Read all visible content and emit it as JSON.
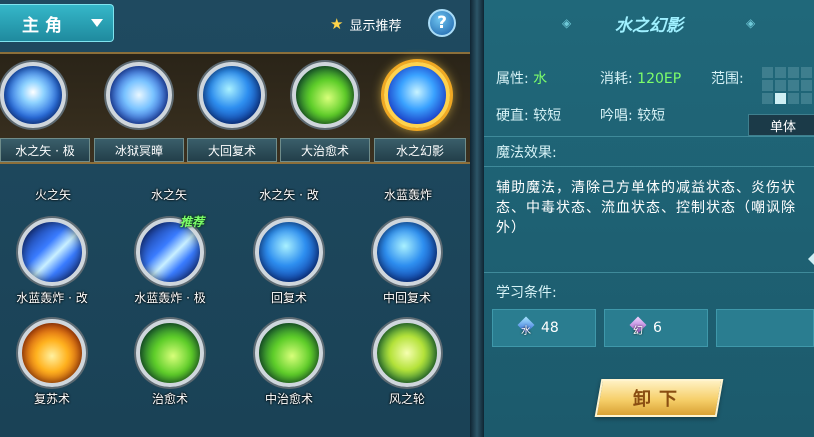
{
  "header": {
    "role_label": "主角",
    "recommend_label": "显示推荐",
    "help_label": "?"
  },
  "equipped": [
    {
      "label": "水之矢 · 极",
      "icon": "ice-arrow-icon"
    },
    {
      "label": "冰狱冥暲",
      "icon": "ice-prison-icon"
    },
    {
      "label": "大回复术",
      "icon": "bubbles-icon"
    },
    {
      "label": "大治愈术",
      "icon": "healing-sprout-icon"
    },
    {
      "label": "水之幻影",
      "icon": "water-phantom-icon",
      "selected": true
    }
  ],
  "skills": [
    {
      "name": "火之矢",
      "icon": "fire-arrow-icon"
    },
    {
      "name": "水之矢",
      "icon": "water-arrow-icon"
    },
    {
      "name": "水之矢 · 改",
      "icon": "water-arrow-icon"
    },
    {
      "name": "水蓝轰炸",
      "icon": "water-blast-icon"
    },
    {
      "name": "水蓝轰炸 · 改",
      "icon": "water-blast-icon"
    },
    {
      "name": "水蓝轰炸 · 极",
      "icon": "water-blast-icon",
      "tag": "推荐"
    },
    {
      "name": "回复术",
      "icon": "bubbles-icon"
    },
    {
      "name": "中回复术",
      "icon": "bubbles-icon"
    },
    {
      "name": "复苏术",
      "icon": "phoenix-icon"
    },
    {
      "name": "治愈术",
      "icon": "healing-sprout-icon"
    },
    {
      "name": "中治愈术",
      "icon": "healing-sprout-icon"
    },
    {
      "name": "风之轮",
      "icon": "wind-wheel-icon"
    }
  ],
  "detail": {
    "title": "水之幻影",
    "attribute_label": "属性:",
    "attribute_value": "水",
    "cost_label": "消耗:",
    "cost_value": "120EP",
    "range_label": "范围:",
    "stiffness_label": "硬直:",
    "stiffness_value": "较短",
    "chant_label": "吟唱:",
    "chant_value": "较短",
    "scope": "单体",
    "effect_label": "魔法效果:",
    "effect_text": "辅助魔法，清除己方单体的减益状态、炎伤状态、中毒状态、流血状态、控制状态（嘲讽除外）",
    "learn_label": "学习条件:",
    "requirements": [
      {
        "element": "水",
        "amount": "48",
        "icon": "water-crystal-icon"
      },
      {
        "element": "幻",
        "amount": "6",
        "icon": "arcane-crystal-icon"
      }
    ],
    "unload_label": "卸下"
  },
  "colors": {
    "accent": "#35b7c9",
    "element_green": "#7dff6a",
    "title_cyan": "#9ff0ff",
    "button_gold": "#f6cf6a"
  }
}
